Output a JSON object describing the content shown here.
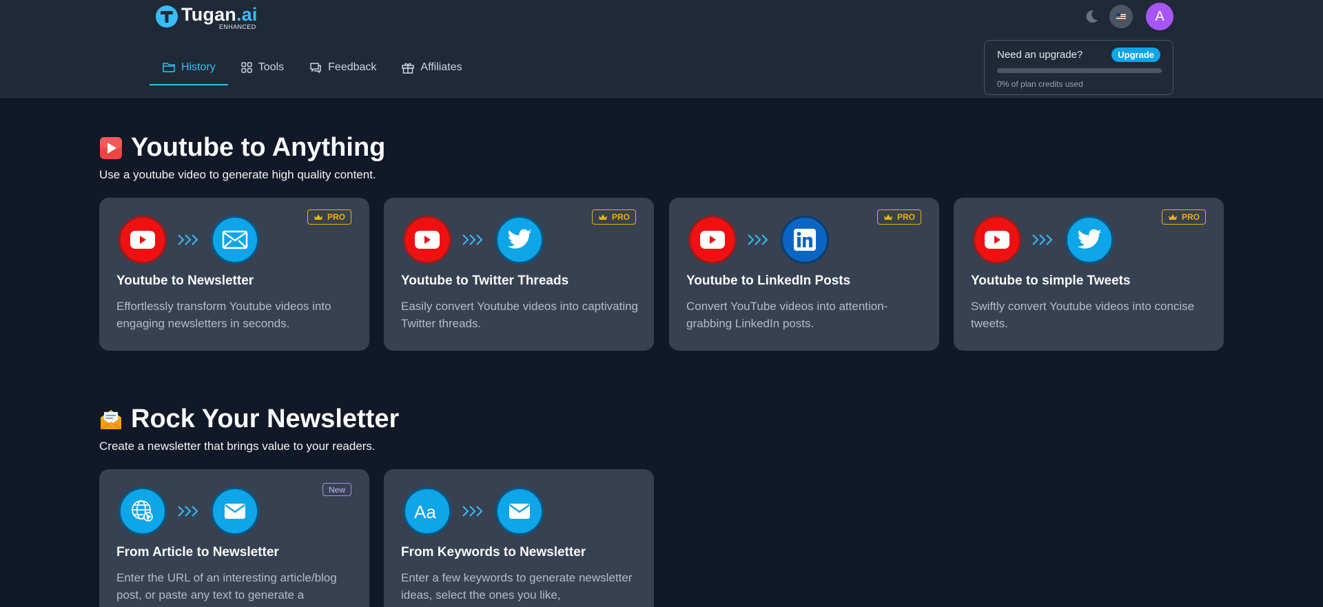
{
  "brand": {
    "name": "Tugan",
    "suffix": ".ai",
    "tagline": "ENHANCED"
  },
  "nav": [
    {
      "label": "History",
      "icon": "folder-icon",
      "active": true
    },
    {
      "label": "Tools",
      "icon": "grid-icon",
      "active": false
    },
    {
      "label": "Feedback",
      "icon": "chat-icon",
      "active": false
    },
    {
      "label": "Affiliates",
      "icon": "gift-icon",
      "active": false
    }
  ],
  "header_controls": {
    "theme_icon": "moon-icon",
    "language_icon": "us-flag-icon",
    "avatar_letter": "A"
  },
  "upgrade": {
    "title": "Need an upgrade?",
    "button": "Upgrade",
    "credits_used_fraction": 0,
    "note": "0% of plan credits used"
  },
  "sections": [
    {
      "title": "Youtube to Anything",
      "subtitle": "Use a youtube video to generate high quality content.",
      "icon": "play-button-icon",
      "cards": [
        {
          "title": "Youtube to Newsletter",
          "desc": "Effortlessly transform Youtube videos into engaging newsletters in seconds.",
          "badge": "PRO",
          "from": "youtube-icon",
          "to": "envelope-icon"
        },
        {
          "title": "Youtube to Twitter Threads",
          "desc": "Easily convert Youtube videos into captivating Twitter threads.",
          "badge": "PRO",
          "from": "youtube-icon",
          "to": "twitter-icon"
        },
        {
          "title": "Youtube to LinkedIn Posts",
          "desc": "Convert YouTube videos into attention-grabbing LinkedIn posts.",
          "badge": "PRO",
          "from": "youtube-icon",
          "to": "linkedin-icon"
        },
        {
          "title": "Youtube to simple Tweets",
          "desc": "Swiftly convert Youtube videos into concise tweets.",
          "badge": "PRO",
          "from": "youtube-icon",
          "to": "twitter-icon"
        }
      ]
    },
    {
      "title": "Rock Your Newsletter",
      "subtitle": "Create a newsletter that brings value to your readers.",
      "icon": "envelope-with-letter-icon",
      "cards": [
        {
          "title": "From Article to Newsletter",
          "desc": "Enter the URL of an interesting article/blog post, or paste any text to generate a",
          "badge": "New",
          "from": "globe-cursor-icon",
          "to": "envelope-icon"
        },
        {
          "title": "From Keywords to Newsletter",
          "desc": "Enter a few keywords to generate newsletter ideas, select the ones you like,",
          "badge": "",
          "from": "font-aa-icon",
          "to": "envelope-icon"
        }
      ]
    }
  ]
}
